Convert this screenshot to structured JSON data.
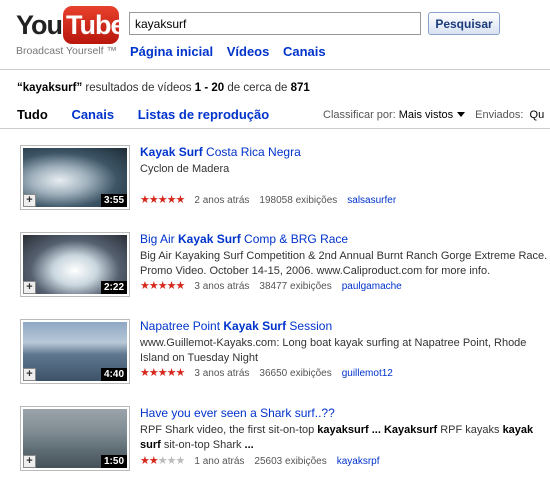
{
  "header": {
    "logo_you": "You",
    "logo_tube": "Tube",
    "tagline": "Broadcast Yourself ™",
    "search_value": "kayaksurf",
    "search_button": "Pesquisar",
    "nav": [
      "Página inicial",
      "Vídeos",
      "Canais"
    ]
  },
  "summary": {
    "query": "“kayaksurf”",
    "text1": " resultados de vídeos ",
    "range": "1 - 20",
    "text2": " de cerca de ",
    "total": "871"
  },
  "tabs": [
    "Tudo",
    "Canais",
    "Listas de reprodução"
  ],
  "sort": {
    "label": "Classificar por:",
    "value": "Mais vistos",
    "uploaded_label": "Enviados:",
    "uploaded_value": "Qu"
  },
  "results": [
    {
      "title_parts": [
        {
          "t": "Kayak Surf",
          "b": true
        },
        {
          "t": " Costa Rica Negra",
          "b": false
        }
      ],
      "desc_parts": [
        {
          "t": "Cyclon de Madera",
          "b": false
        }
      ],
      "duration": "3:55",
      "rating": 4.5,
      "age": "2 anos atrás",
      "views": "198058 exibições",
      "user": "salsasurfer"
    },
    {
      "title_parts": [
        {
          "t": "Big Air ",
          "b": false
        },
        {
          "t": "Kayak Surf",
          "b": true
        },
        {
          "t": " Comp & BRG Race",
          "b": false
        }
      ],
      "desc_parts": [
        {
          "t": "Big Air Kayaking Surf Competition & 2nd Annual Burnt Ranch Gorge Extreme Race. Promo Video. October 14-15, 2006. www.Caliproduct.com for more info.",
          "b": false
        }
      ],
      "duration": "2:22",
      "rating": 4.5,
      "age": "3 anos atrás",
      "views": "38477 exibições",
      "user": "paulgamache"
    },
    {
      "title_parts": [
        {
          "t": "Napatree Point ",
          "b": false
        },
        {
          "t": "Kayak Surf",
          "b": true
        },
        {
          "t": " Session",
          "b": false
        }
      ],
      "desc_parts": [
        {
          "t": "www.Guillemot-Kayaks.com: Long boat kayak surfing at Napatree Point, Rhode Island on Tuesday Night",
          "b": false
        }
      ],
      "duration": "4:40",
      "rating": 4.5,
      "age": "3 anos atrás",
      "views": "36650 exibições",
      "user": "guillemot12"
    },
    {
      "title_parts": [
        {
          "t": "Have you ever seen a Shark surf..??",
          "b": false
        }
      ],
      "desc_parts": [
        {
          "t": "RPF Shark video, the first sit-on-top ",
          "b": false
        },
        {
          "t": "kayaksurf ... Kayaksurf",
          "b": true
        },
        {
          "t": " RPF kayaks ",
          "b": false
        },
        {
          "t": "kayak surf",
          "b": true
        },
        {
          "t": " sit-on-top Shark ",
          "b": false
        },
        {
          "t": "...",
          "b": true
        }
      ],
      "duration": "1:50",
      "rating": 1.5,
      "age": "1 ano atrás",
      "views": "25603 exibições",
      "user": "kayaksrpf"
    }
  ],
  "colors": {
    "link": "#0033cc",
    "star": "#d6271b",
    "logo_red": "#cc2211"
  }
}
